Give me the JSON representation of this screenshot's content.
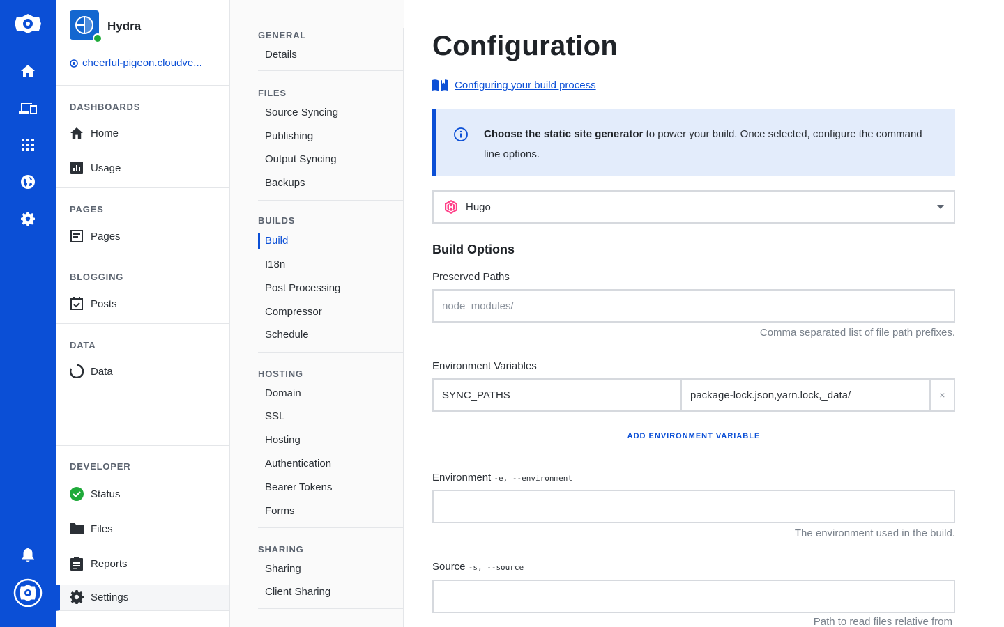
{
  "rail": {
    "icons": [
      "cloudcannon-logo-icon",
      "home-icon",
      "devices-icon",
      "apps-grid-icon",
      "globe-icon",
      "gear-icon",
      "bell-icon",
      "account-icon"
    ]
  },
  "site": {
    "name": "Hydra",
    "url": "cheerful-pigeon.cloudve..."
  },
  "sidebar": {
    "dashboards": {
      "title": "DASHBOARDS",
      "items": [
        "Home",
        "Usage"
      ]
    },
    "pages": {
      "title": "PAGES",
      "items": [
        "Pages"
      ]
    },
    "blogging": {
      "title": "BLOGGING",
      "items": [
        "Posts"
      ]
    },
    "data": {
      "title": "DATA",
      "items": [
        "Data"
      ]
    },
    "developer": {
      "title": "DEVELOPER",
      "items": [
        "Status",
        "Files",
        "Reports",
        "Settings"
      ]
    }
  },
  "settings_nav": {
    "general": {
      "title": "GENERAL",
      "items": [
        "Details"
      ]
    },
    "files": {
      "title": "FILES",
      "items": [
        "Source Syncing",
        "Publishing",
        "Output Syncing",
        "Backups"
      ]
    },
    "builds": {
      "title": "BUILDS",
      "items": [
        "Build",
        "I18n",
        "Post Processing",
        "Compressor",
        "Schedule"
      ]
    },
    "hosting": {
      "title": "HOSTING",
      "items": [
        "Domain",
        "SSL",
        "Hosting",
        "Authentication",
        "Bearer Tokens",
        "Forms"
      ]
    },
    "sharing": {
      "title": "SHARING",
      "items": [
        "Sharing",
        "Client Sharing"
      ]
    },
    "active": "Build"
  },
  "main": {
    "title": "Configuration",
    "doc_link": "Configuring your build process",
    "info": {
      "bold": "Choose the static site generator",
      "rest": " to power your build. Once selected, configure the command line options."
    },
    "generator": "Hugo",
    "build_options_title": "Build Options",
    "preserved_paths": {
      "label": "Preserved Paths",
      "placeholder": "node_modules/",
      "hint": "Comma separated list of file path prefixes."
    },
    "env_vars": {
      "label": "Environment Variables",
      "key": "SYNC_PATHS",
      "value": "package-lock.json,yarn.lock,_data/",
      "remove": "×",
      "add_label": "ADD ENVIRONMENT VARIABLE"
    },
    "environment": {
      "label": "Environment",
      "flags": "-e, --environment",
      "value": "",
      "hint": "The environment used in the build."
    },
    "source": {
      "label": "Source",
      "flags": "-s, --source",
      "value": "",
      "hint": "Path to read files relative from"
    }
  },
  "colors": {
    "accent": "#0b4fd6",
    "success": "#1faa3a",
    "info_bg": "#e3ecfb",
    "hugo": "#ff4088"
  }
}
